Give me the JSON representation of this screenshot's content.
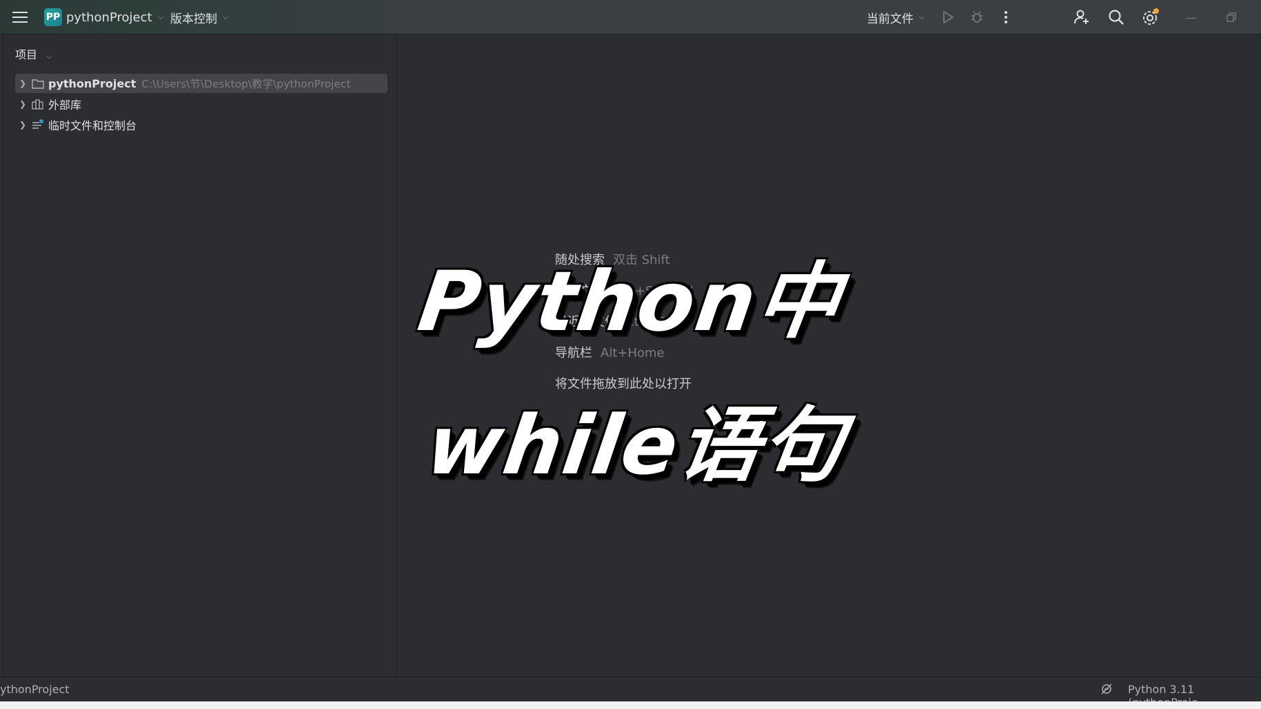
{
  "titlebar": {
    "logo": "PP",
    "project_name": "pythonProject",
    "vcs_label": "版本控制",
    "run_config": "当前文件"
  },
  "sidebar": {
    "title": "项目",
    "tree": [
      {
        "label": "pythonProject",
        "path": "C:\\Users\\节\\Desktop\\教学\\pythonProject"
      },
      {
        "label": "外部库",
        "path": ""
      },
      {
        "label": "临时文件和控制台",
        "path": ""
      }
    ]
  },
  "editor": {
    "hints": [
      {
        "label": "随处搜索",
        "key": "双击 Shift"
      },
      {
        "label": "转到文件",
        "key": "Ctrl+Shift+N"
      },
      {
        "label": "最近的文件",
        "key": "Ctrl+E"
      },
      {
        "label": "导航栏",
        "key": "Alt+Home"
      },
      {
        "label": "将文件拖放到此处以打开",
        "key": ""
      }
    ]
  },
  "overlay": {
    "line1": "Python中",
    "line2": "while语句"
  },
  "statusbar": {
    "left": "ythonProject",
    "right": "Python 3.11 (pythonProje"
  },
  "colors": {
    "accent_teal": "#23a2a0",
    "notification_dot": "#f0a732"
  }
}
